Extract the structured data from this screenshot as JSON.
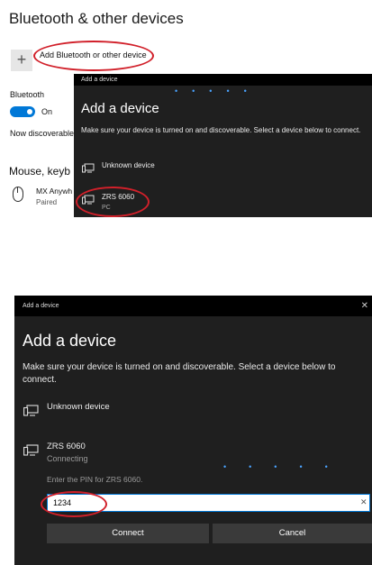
{
  "settings": {
    "title": "Bluetooth & other devices",
    "add_button_symbol": "+",
    "add_label": "Add Bluetooth or other device",
    "bluetooth_label": "Bluetooth",
    "toggle_state": "On",
    "discoverable_text": "Now discoverable",
    "mouse_section_title": "Mouse, keyb",
    "mouse_device_name": "MX Anywh",
    "mouse_device_status": "Paired",
    "accent_color": "#0078d7"
  },
  "dialog_small": {
    "bar_title": "Add a device",
    "heading": "Add a device",
    "instruction": "Make sure your device is turned on and discoverable. Select a device below to connect.",
    "devices": [
      {
        "name": "Unknown device",
        "icon": "monitor-icon"
      },
      {
        "name": "ZRS 6060",
        "status": "PC",
        "icon": "pc-icon"
      }
    ]
  },
  "dialog_large": {
    "bar_title": "Add a device",
    "close_symbol": "✕",
    "heading": "Add a device",
    "instruction": "Make sure your device is turned on and discoverable. Select a device below to connect.",
    "devices": [
      {
        "name": "Unknown device",
        "icon": "monitor-icon"
      },
      {
        "name": "ZRS 6060",
        "status": "Connecting",
        "icon": "pc-icon"
      }
    ],
    "pin_prompt": "Enter the PIN for ZRS 6060.",
    "pin_value": "1234",
    "clear_symbol": "✕",
    "connect_label": "Connect",
    "cancel_label": "Cancel"
  },
  "highlight_color": "#d1202a"
}
